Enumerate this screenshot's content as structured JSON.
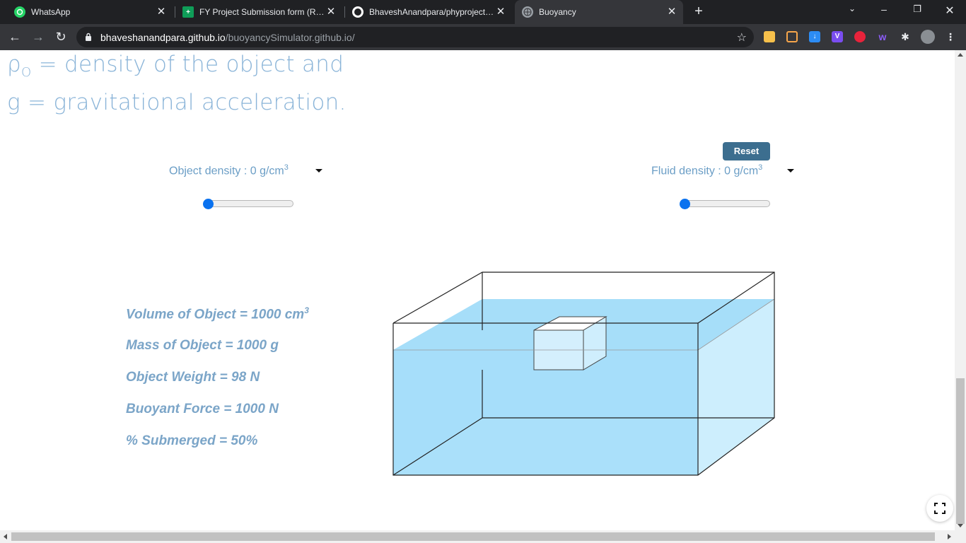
{
  "browser": {
    "tabs": [
      {
        "label": "WhatsApp",
        "icon": "whatsapp-icon"
      },
      {
        "label": "FY Project Submission form (Resp",
        "icon": "sheets-icon"
      },
      {
        "label": "BhaveshAnandpara/phyproject: A",
        "icon": "github-icon"
      },
      {
        "label": "Buoyancy",
        "icon": "globe-icon",
        "active": true
      }
    ],
    "url_host": "bhaveshanandpara.github.io",
    "url_path": "/buoyancySimulator.github.io/"
  },
  "page": {
    "formula_lines": [
      {
        "symbol": "ρ",
        "sub": "O",
        "text": " = density of the object and"
      },
      {
        "text": "g = gravitational acceleration."
      }
    ],
    "reset_label": "Reset",
    "object_density": {
      "label": "Object density : 0 g/cm",
      "sup": "3",
      "value": 0
    },
    "fluid_density": {
      "label": "Fluid density : 0 g/cm",
      "sup": "3",
      "value": 0
    },
    "info": {
      "volume": {
        "text": "Volume of Object = 1000 cm",
        "sup": "3"
      },
      "mass": "Mass of Object = 1000 g",
      "weight": "Object Weight = 98 N",
      "buoyant": "Buoyant Force = 1000 N",
      "submerged": "% Submerged = 50%"
    }
  },
  "colors": {
    "water_front": "#a6def9",
    "water_light": "#cdeefd",
    "label_blue": "#6b9ec6",
    "button_blue": "#3c6e8f",
    "slider_blue": "#0a72ef"
  }
}
